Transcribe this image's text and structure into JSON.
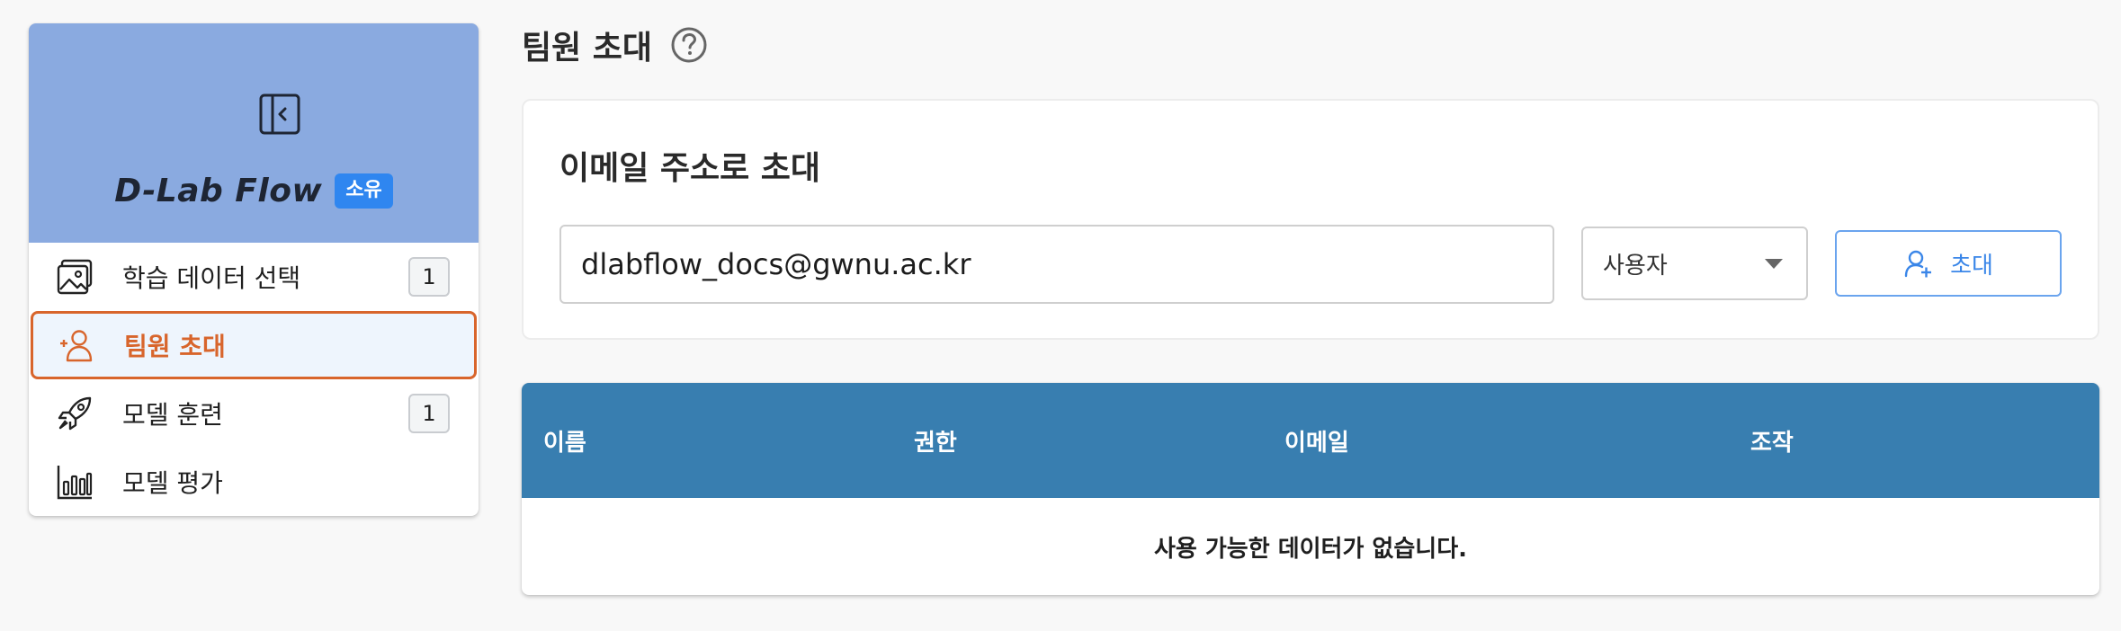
{
  "sidebar": {
    "brand": "D-Lab Flow",
    "owner_badge": "소유",
    "items": [
      {
        "label": "학습 데이터 선택",
        "icon": "image-gallery-icon",
        "count": "1"
      },
      {
        "label": "팀원 초대",
        "icon": "add-user-icon",
        "active": true
      },
      {
        "label": "모델 훈련",
        "icon": "rocket-icon",
        "count": "1"
      },
      {
        "label": "모델 평가",
        "icon": "bar-chart-icon"
      }
    ]
  },
  "page": {
    "title": "팀원 초대"
  },
  "invite": {
    "heading": "이메일 주소로 초대",
    "email_value": "dlabflow_docs@gwnu.ac.kr",
    "role_selected": "사용자",
    "button_label": "초대"
  },
  "table": {
    "columns": [
      "이름",
      "권한",
      "이메일",
      "조작"
    ],
    "empty_message": "사용 가능한 데이터가 없습니다."
  },
  "colors": {
    "sidebar_header": "#8aaae0",
    "active_accent": "#d8652c",
    "table_header": "#387eb0",
    "primary_button": "#3a86e8",
    "owner_badge": "#2f86f0"
  }
}
